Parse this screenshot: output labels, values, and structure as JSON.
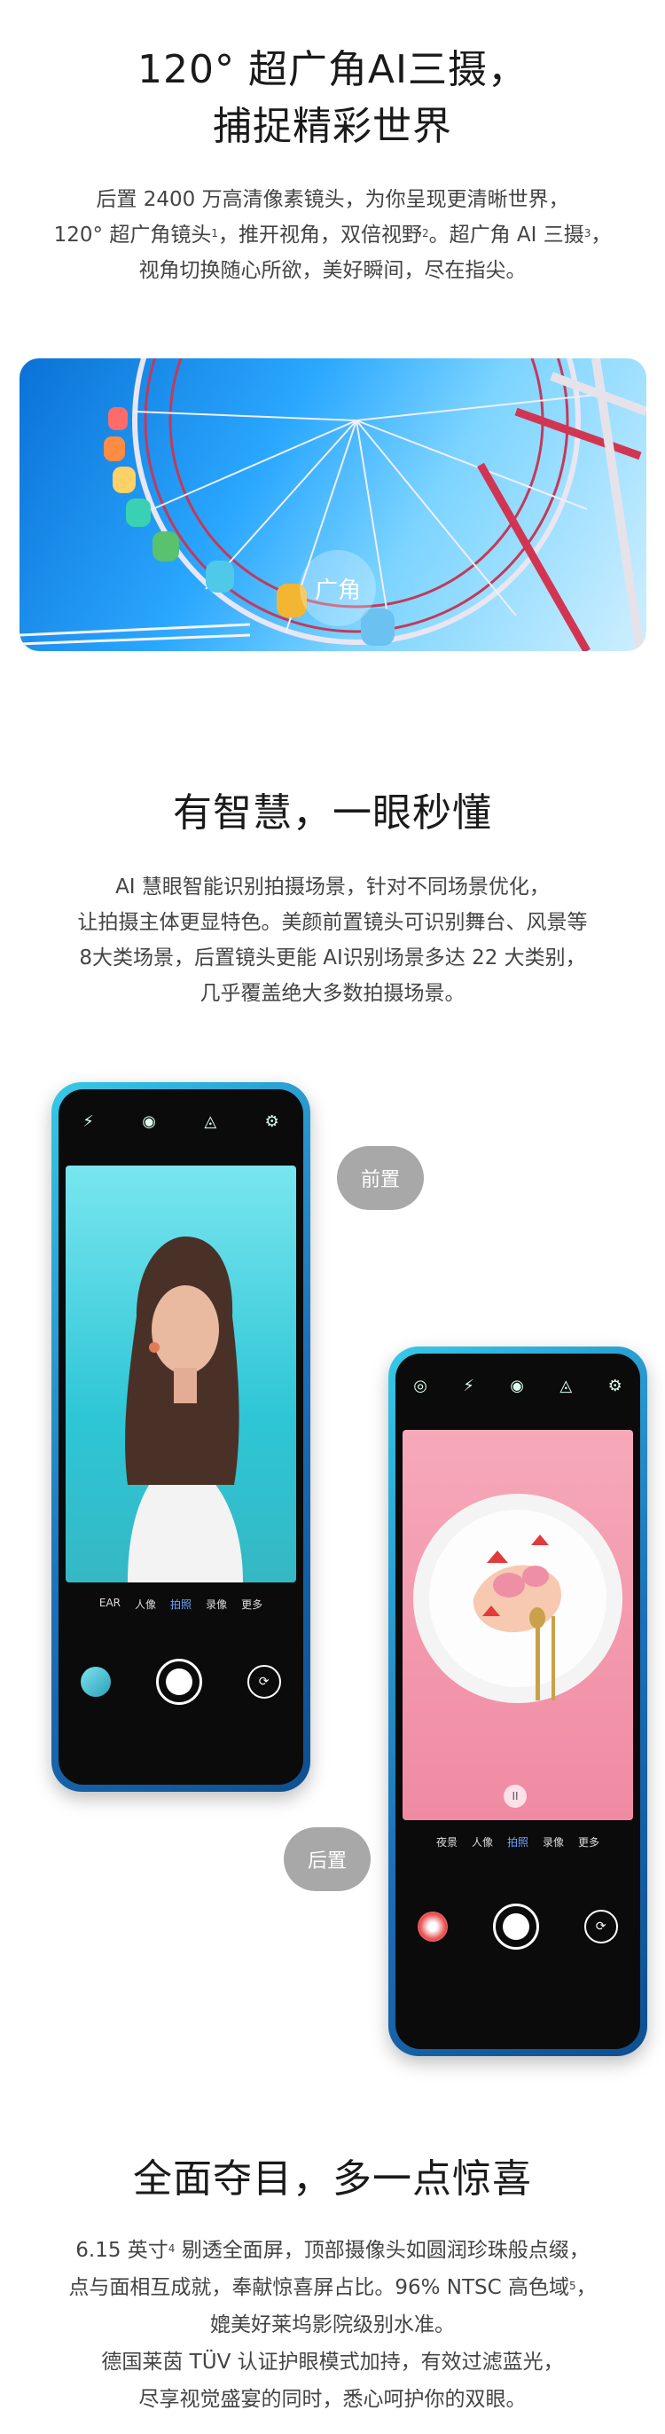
{
  "section1": {
    "title_line1": "120° 超广角AI三摄，",
    "title_line2": "捕捉精彩世界",
    "para_line1": "后置 2400 万高清像素镜头，为你呈现更清晰世界，",
    "para_line2_a": "120° 超广角镜头",
    "para_line2_sup1": "1",
    "para_line2_b": "，推开视角，双倍视野",
    "para_line2_sup2": "2",
    "para_line2_c": "。超广角 AI 三摄",
    "para_line2_sup3": "3",
    "para_line2_d": "，",
    "para_line3": "视角切换随心所欲，美好瞬间，尽在指尖。",
    "badge": "广角"
  },
  "section2": {
    "title": "有智慧，一眼秒懂",
    "para_line1": "AI 慧眼智能识别拍摄场景，针对不同场景优化，",
    "para_line2": "让拍摄主体更显特色。美颜前置镜头可识别舞台、风景等",
    "para_line3": "8大类场景，后置镜头更能 AI识别场景多达 22 大类别，",
    "para_line4": "几乎覆盖绝大多数拍摄场景。",
    "front_label": "前置",
    "rear_label": "后置",
    "front_modes": [
      "EAR",
      "人像",
      "拍照",
      "录像",
      "更多"
    ],
    "rear_modes": [
      "夜景",
      "人像",
      "拍照",
      "录像",
      "更多"
    ],
    "pause_glyph": "II"
  },
  "section3": {
    "title": "全面夺目，多一点惊喜",
    "para_line1_a": "6.15 英寸",
    "para_line1_sup": "4",
    "para_line1_b": " 剔透全面屏，顶部摄像头如圆润珍珠般点缀，",
    "para_line2_a": "点与面相互成就，奉献惊喜屏占比。96% NTSC 高色域",
    "para_line2_sup": "5",
    "para_line2_b": "，",
    "para_line3": "媲美好莱坞影院级别水准。",
    "para_line4": "德国莱茵 TÜV 认证护眼模式加持，有效过滤蓝光，",
    "para_line5": "尽享视觉盛宴的同时，悉心呵护你的双眼。"
  }
}
